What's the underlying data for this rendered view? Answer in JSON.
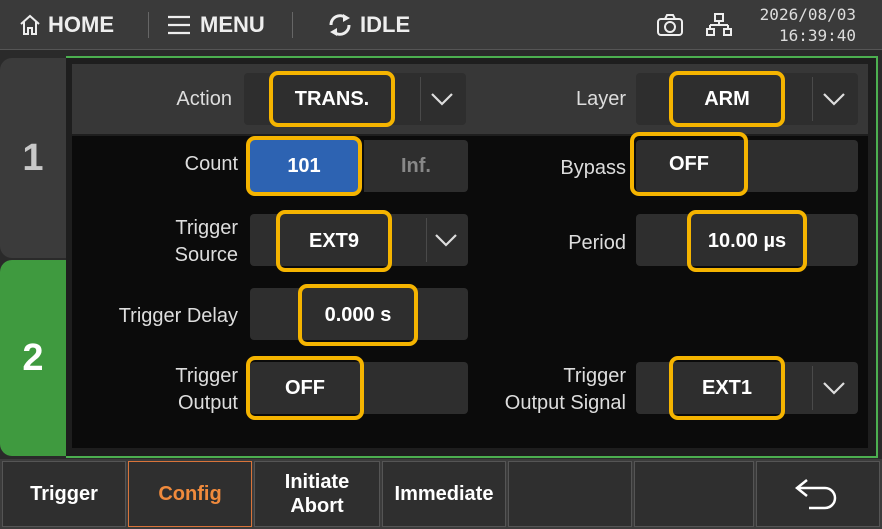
{
  "topbar": {
    "home_label": "HOME",
    "menu_label": "MENU",
    "status_label": "IDLE",
    "date": "2026/08/03",
    "time": "16:39:40"
  },
  "tabs": [
    {
      "label": "1"
    },
    {
      "label": "2"
    }
  ],
  "header": {
    "action_label": "Action",
    "action_value": "TRANS.",
    "layer_label": "Layer",
    "layer_value": "ARM"
  },
  "settings": {
    "count_label": "Count",
    "count_value": "101",
    "count_inf": "Inf.",
    "bypass_label": "Bypass",
    "bypass_value": "OFF",
    "trigger_source_label_1": "Trigger",
    "trigger_source_label_2": "Source",
    "trigger_source_value": "EXT9",
    "period_label": "Period",
    "period_value": "10.00 µs",
    "trigger_delay_label": "Trigger Delay",
    "trigger_delay_value": "0.000 s",
    "trigger_output_label_1": "Trigger",
    "trigger_output_label_2": "Output",
    "trigger_output_value": "OFF",
    "trigger_output_signal_label_1": "Trigger",
    "trigger_output_signal_label_2": "Output Signal",
    "trigger_output_signal_value": "EXT1"
  },
  "softkeys": {
    "trigger": "Trigger",
    "config": "Config",
    "initiate": "Initiate",
    "abort": "Abort",
    "immediate": "Immediate"
  },
  "colors": {
    "highlight": "#f5b400",
    "tab_active": "#3f9a3f",
    "count_active": "#2d63b2",
    "softkey_active": "#f08a3c"
  }
}
